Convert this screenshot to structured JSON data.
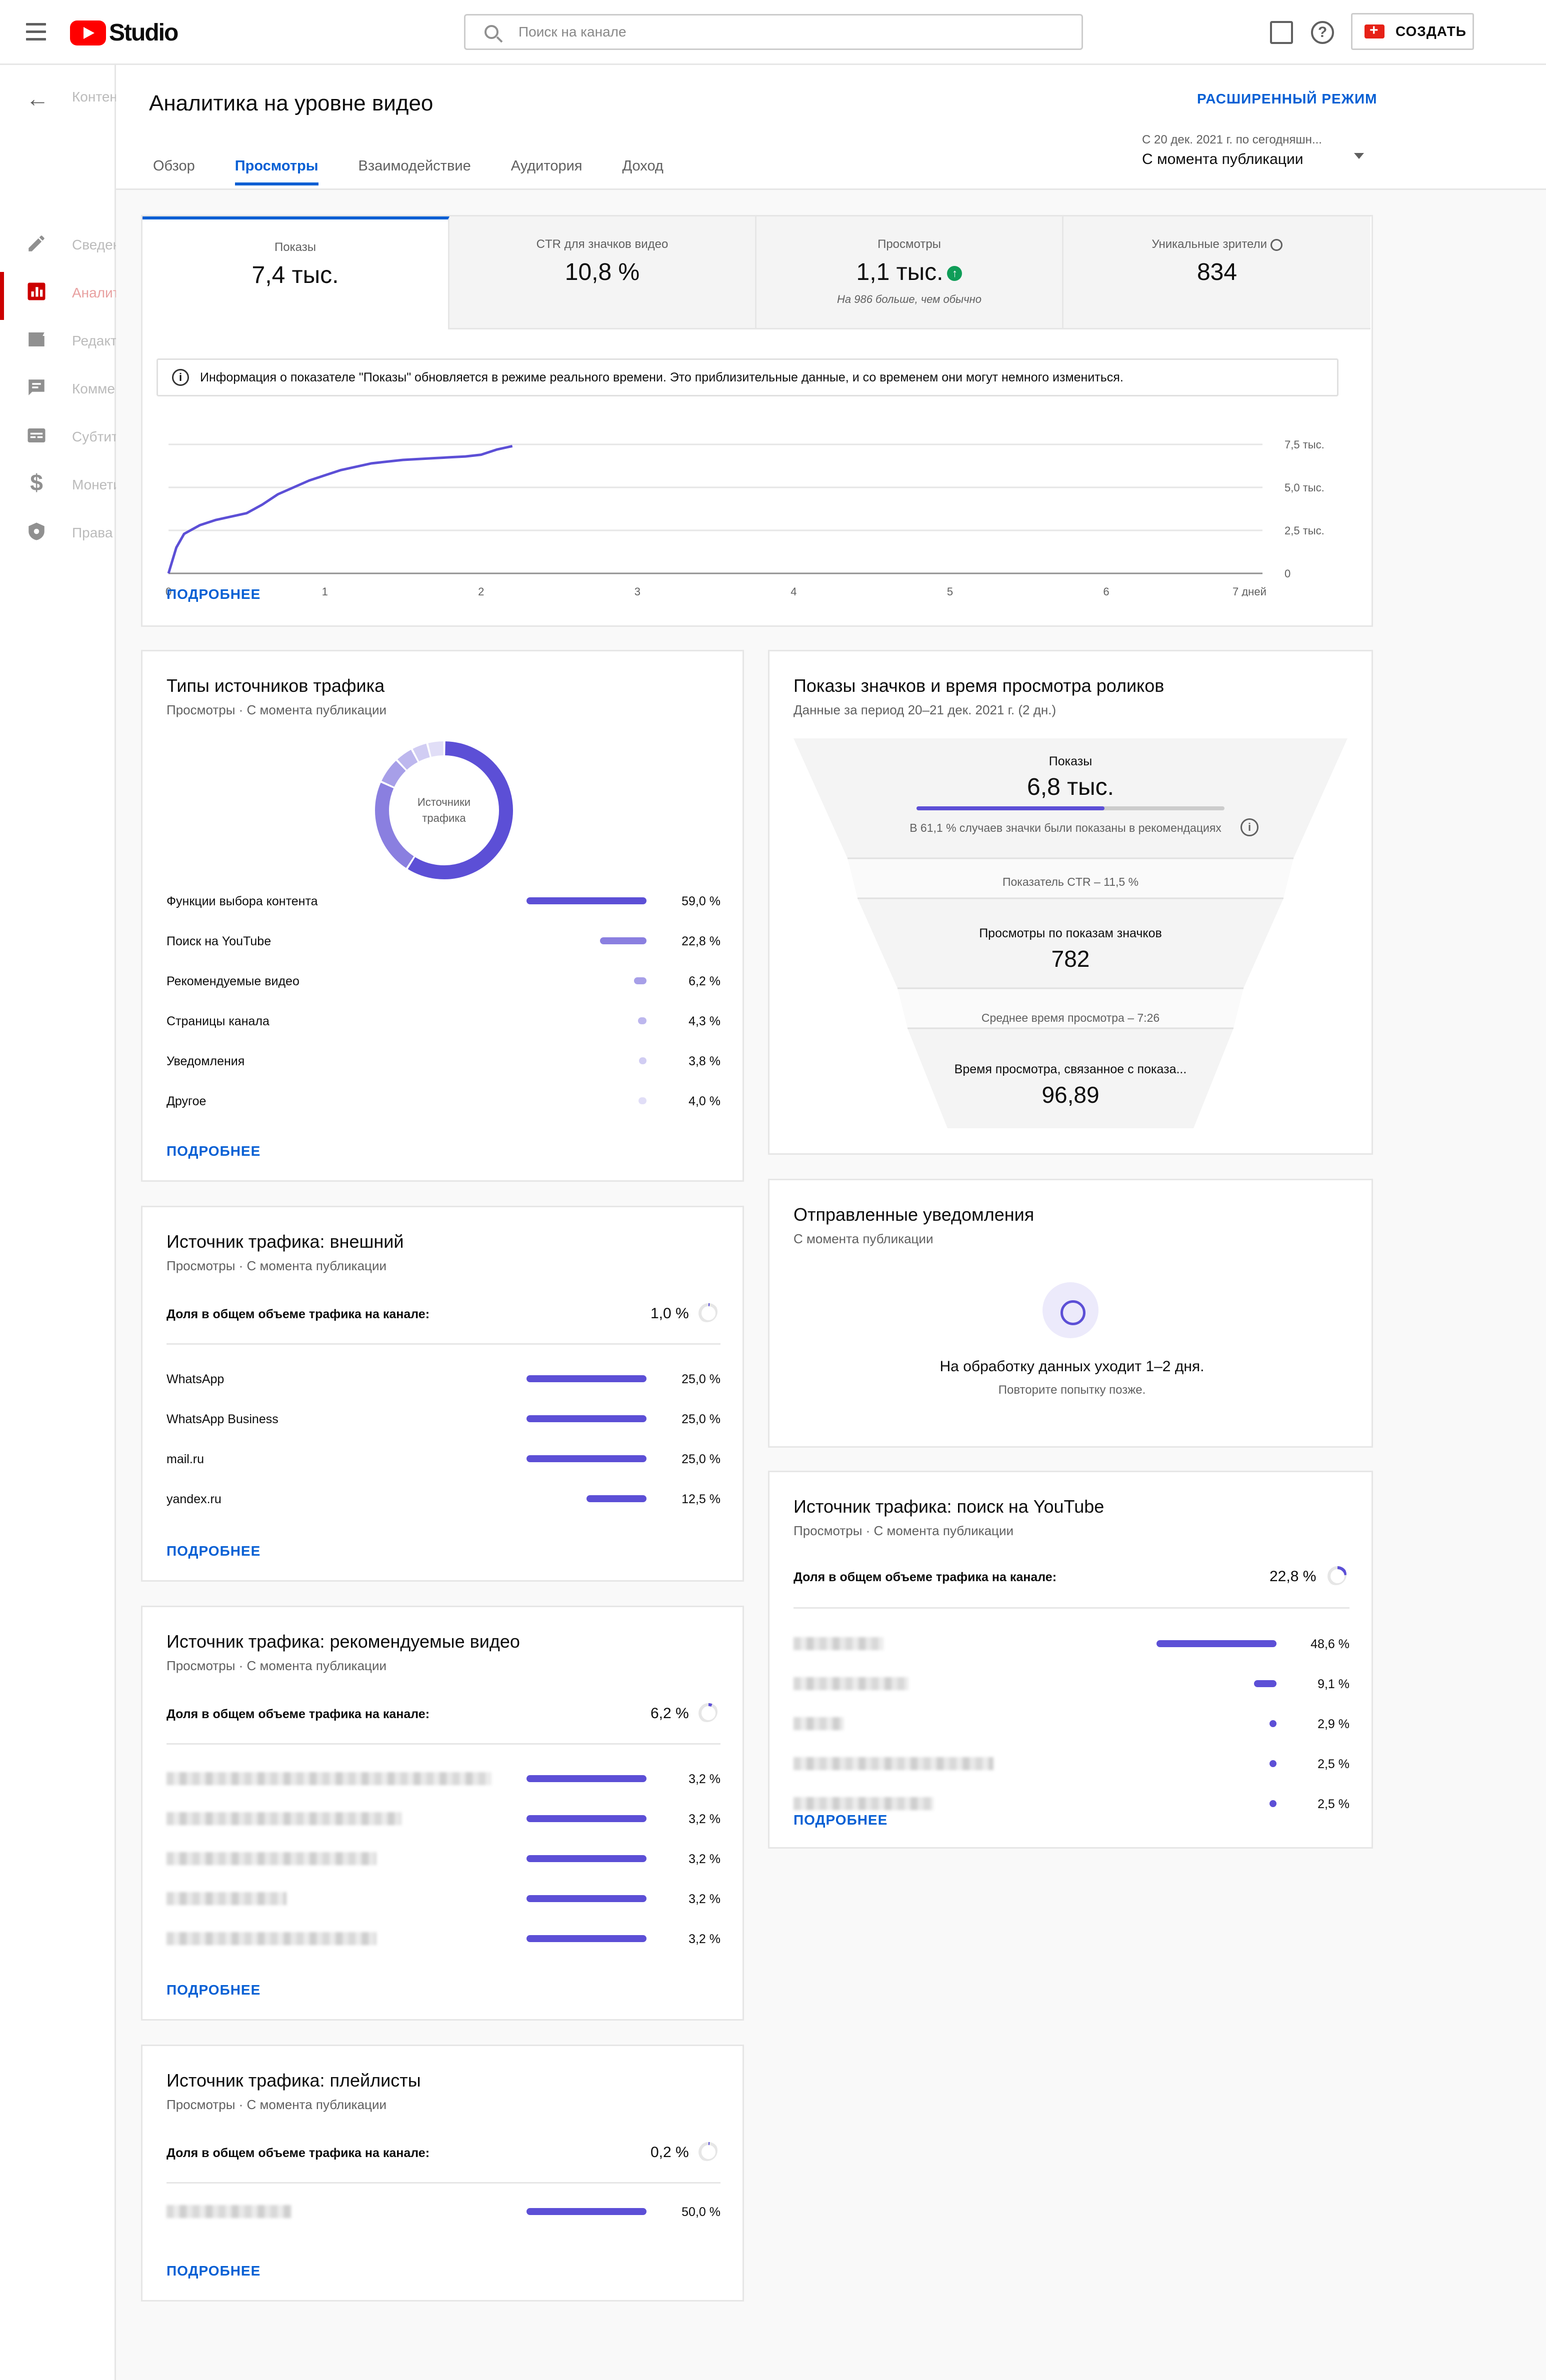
{
  "topbar": {
    "logo_text": "Studio",
    "search_placeholder": "Поиск на канале",
    "create_label": "СОЗДАТЬ"
  },
  "sidebar": {
    "items": [
      {
        "label": "Контент",
        "icon": "back-arrow-icon"
      },
      {
        "label": "Сведения",
        "icon": "pencil-icon"
      },
      {
        "label": "Аналитика",
        "icon": "analytics-icon",
        "active": true
      },
      {
        "label": "Редактор",
        "icon": "clapper-icon"
      },
      {
        "label": "Комментарии",
        "icon": "comment-icon"
      },
      {
        "label": "Субтитры",
        "icon": "subtitles-icon"
      },
      {
        "label": "Монетизация",
        "icon": "dollar-icon"
      },
      {
        "label": "Права",
        "icon": "shield-icon"
      }
    ]
  },
  "header": {
    "title": "Аналитика на уровне видео",
    "advanced_mode": "РАСШИРЕННЫЙ РЕЖИМ",
    "tabs": [
      "Обзор",
      "Просмотры",
      "Взаимодействие",
      "Аудитория",
      "Доход"
    ],
    "active_tab": 1,
    "period_small": "С 20 дек. 2021 г. по сегодняшн...",
    "period_big": "С момента публикации"
  },
  "metrics": {
    "items": [
      {
        "label": "Показы",
        "value": "7,4 тыс."
      },
      {
        "label": "CTR для значков видео",
        "value": "10,8 %"
      },
      {
        "label": "Просмотры",
        "value": "1,1 тыс.",
        "note": "На 986 больше, чем обычно"
      },
      {
        "label": "Уникальные зрители",
        "value": "834"
      }
    ],
    "info": "Информация о показателе \"Показы\" обновляется в режиме реального времени. Это приблизительные данные, и со временем они могут немного измениться.",
    "more": "ПОДРОБНЕЕ"
  },
  "chart_data": {
    "type": "line",
    "x": [
      0,
      0.05,
      0.1,
      0.2,
      0.3,
      0.4,
      0.5,
      0.6,
      0.7,
      0.8,
      0.9,
      1.0,
      1.1,
      1.2,
      1.3,
      1.4,
      1.5,
      1.6,
      1.7,
      1.8,
      1.9,
      2.0,
      2.1,
      2.2
    ],
    "values": [
      0,
      1500,
      2300,
      2800,
      3100,
      3300,
      3500,
      4000,
      4600,
      5000,
      5400,
      5700,
      6000,
      6200,
      6400,
      6500,
      6600,
      6650,
      6700,
      6750,
      6800,
      6900,
      7200,
      7400
    ],
    "series": [
      {
        "values": [
          0,
          1500,
          2300,
          2800,
          3100,
          3300,
          3500,
          4000,
          4600,
          5000,
          5400,
          5700,
          6000,
          6200,
          6400,
          6500,
          6600,
          6650,
          6700,
          6750,
          6800,
          6900,
          7200,
          7400
        ]
      }
    ],
    "x_ticks": [
      "0",
      "1",
      "2",
      "3",
      "4",
      "5",
      "6",
      "7 дней"
    ],
    "y_ticks": [
      "0",
      "2,5 тыс.",
      "5,0 тыс.",
      "7,5 тыс."
    ],
    "xlim": [
      0,
      7
    ],
    "ylim": [
      0,
      7500
    ],
    "grid": true,
    "color": "#5c4fd6"
  },
  "traffic_types": {
    "title": "Типы источников трафика",
    "subtitle": "Просмотры · С момента публикации",
    "donut_label_1": "Источники",
    "donut_label_2": "трафика",
    "rows": [
      {
        "name": "Функции выбора контента",
        "pct": "59,0 %",
        "value": 59.0
      },
      {
        "name": "Поиск на YouTube",
        "pct": "22,8 %",
        "value": 22.8
      },
      {
        "name": "Рекомендуемые видео",
        "pct": "6,2 %",
        "value": 6.2
      },
      {
        "name": "Страницы канала",
        "pct": "4,3 %",
        "value": 4.3
      },
      {
        "name": "Уведомления",
        "pct": "3,8 %",
        "value": 3.8
      },
      {
        "name": "Другое",
        "pct": "4,0 %",
        "value": 4.0
      }
    ],
    "more": "ПОДРОБНЕЕ"
  },
  "funnel": {
    "title": "Показы значков и время просмотра роликов",
    "subtitle": "Данные за период 20–21 дек. 2021 г. (2 дн.)",
    "impressions_label": "Показы",
    "impressions_value": "6,8 тыс.",
    "recommend_share": 0.611,
    "recommend_text": "В 61,1 % случаев значки были показаны в рекомендациях",
    "ctr_text": "Показатель CTR – 11,5 %",
    "views_label": "Просмотры по показам значков",
    "views_value": "782",
    "avg_text": "Среднее время просмотра – 7:26",
    "watch_label": "Время просмотра, связанное с показа...",
    "watch_value": "96,89"
  },
  "notifications": {
    "title": "Отправленные уведомления",
    "subtitle": "С момента публикации",
    "message": "На обработку данных уходит 1–2 дня.",
    "retry": "Повторите попытку позже."
  },
  "external": {
    "title": "Источник трафика: внешний",
    "subtitle": "Просмотры · С момента публикации",
    "share_label": "Доля в общем объеме трафика на канале:",
    "share_value": "1,0 %",
    "share_fraction": 0.01,
    "rows": [
      {
        "name": "WhatsApp",
        "pct": "25,0 %",
        "value": 25.0
      },
      {
        "name": "WhatsApp Business",
        "pct": "25,0 %",
        "value": 25.0
      },
      {
        "name": "mail.ru",
        "pct": "25,0 %",
        "value": 25.0
      },
      {
        "name": "yandex.ru",
        "pct": "12,5 %",
        "value": 12.5
      }
    ],
    "more": "ПОДРОБНЕЕ"
  },
  "yt_search": {
    "title": "Источник трафика: поиск на YouTube",
    "subtitle": "Просмотры · С момента публикации",
    "share_label": "Доля в общем объеме трафика на канале:",
    "share_value": "22,8 %",
    "share_fraction": 0.228,
    "rows": [
      {
        "pct": "48,6 %",
        "value": 48.6
      },
      {
        "pct": "9,1 %",
        "value": 9.1
      },
      {
        "pct": "2,9 %",
        "value": 2.9
      },
      {
        "pct": "2,5 %",
        "value": 2.5
      },
      {
        "pct": "2,5 %",
        "value": 2.5
      }
    ],
    "more": "ПОДРОБНЕЕ"
  },
  "suggested": {
    "title": "Источник трафика: рекомендуемые видео",
    "subtitle": "Просмотры · С момента публикации",
    "share_label": "Доля в общем объеме трафика на канале:",
    "share_value": "6,2 %",
    "share_fraction": 0.062,
    "rows": [
      {
        "pct": "3,2 %",
        "value": 3.2
      },
      {
        "pct": "3,2 %",
        "value": 3.2
      },
      {
        "pct": "3,2 %",
        "value": 3.2
      },
      {
        "pct": "3,2 %",
        "value": 3.2
      },
      {
        "pct": "3,2 %",
        "value": 3.2
      }
    ],
    "more": "ПОДРОБНЕЕ"
  },
  "playlists": {
    "title": "Источник трафика: плейлисты",
    "subtitle": "Просмотры · С момента публикации",
    "share_label": "Доля в общем объеме трафика на канале:",
    "share_value": "0,2 %",
    "share_fraction": 0.002,
    "rows": [
      {
        "pct": "50,0 %",
        "value": 50.0
      }
    ],
    "more": "ПОДРОБНЕЕ"
  }
}
